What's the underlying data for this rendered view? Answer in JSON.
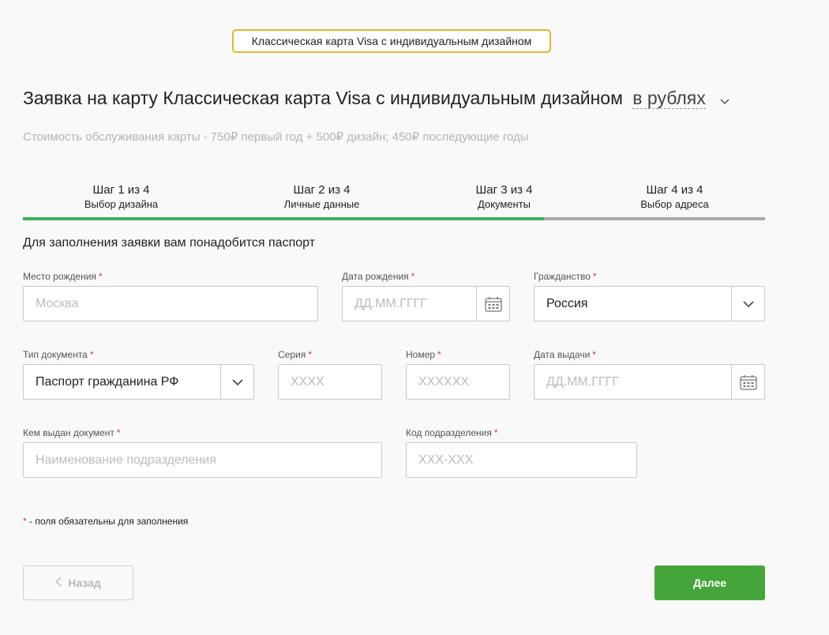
{
  "header": {
    "badge": "Классическая карта Visa с индивидуальным дизайном",
    "title": "Заявка на карту Классическая карта Visa с индивидуальным дизайном",
    "currency": "в рублях",
    "cost": "Стоимость обслуживания карты - 750₽ первый год + 500₽ дизайн; 450₽ последующие годы"
  },
  "steps": [
    {
      "title": "Шаг 1 из 4",
      "subtitle": "Выбор дизайна"
    },
    {
      "title": "Шаг 2 из 4",
      "subtitle": "Личные данные"
    },
    {
      "title": "Шаг 3 из 4",
      "subtitle": "Документы"
    },
    {
      "title": "Шаг 4 из 4",
      "subtitle": "Выбор адреса"
    }
  ],
  "progress": {
    "completed_steps": 3,
    "total_steps": 4
  },
  "form": {
    "note": "Для заполнения заявки вам понадобится паспорт",
    "required_mark": "*",
    "birth_place": {
      "label": "Место рождения",
      "placeholder": "Москва"
    },
    "birth_date": {
      "label": "Дата рождения",
      "placeholder": "ДД.ММ.ГГГГ"
    },
    "citizenship": {
      "label": "Гражданство",
      "value": "Россия"
    },
    "doc_type": {
      "label": "Тип документа",
      "value": "Паспорт гражданина РФ"
    },
    "series": {
      "label": "Серия",
      "placeholder": "XXXX"
    },
    "number": {
      "label": "Номер",
      "placeholder": "XXXXXX"
    },
    "issue_date": {
      "label": "Дата выдачи",
      "placeholder": "ДД.ММ.ГГГГ"
    },
    "issued_by": {
      "label": "Кем выдан документ",
      "placeholder": "Наименование подразделения"
    },
    "division_code": {
      "label": "Код подразделения",
      "placeholder": "XXX-XXX"
    },
    "required_note": " - поля обязательны для заполнения"
  },
  "buttons": {
    "back": "Назад",
    "next": "Далее"
  },
  "colors": {
    "accent": "#3fb05a",
    "button": "#44a63a",
    "badge_border": "#e5b72e",
    "required": "#d23c3c"
  }
}
